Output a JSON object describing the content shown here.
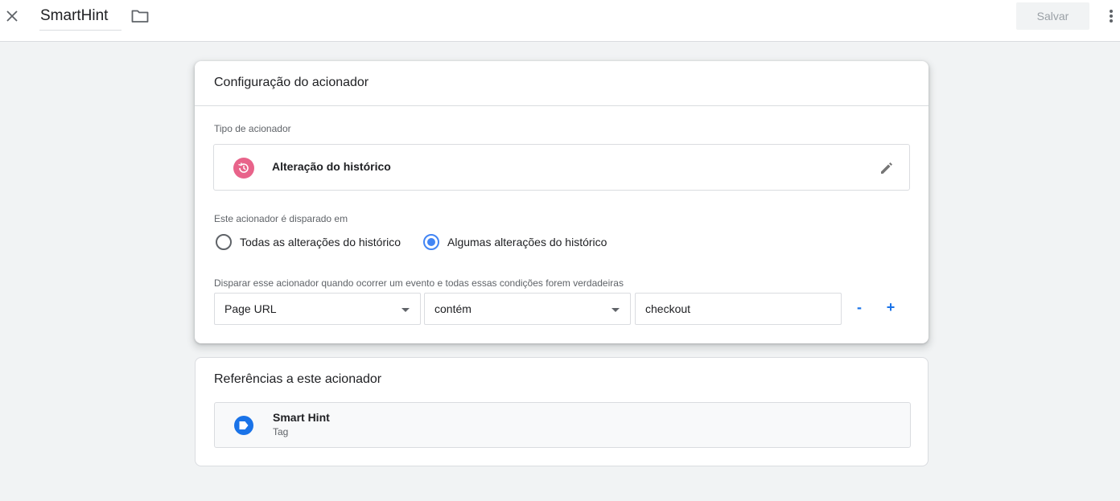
{
  "header": {
    "title": "SmartHint",
    "save_label": "Salvar"
  },
  "config": {
    "title": "Configuração do acionador",
    "trigger_type_label": "Tipo de acionador",
    "trigger_type_name": "Alteração do histórico",
    "fires_on_label": "Este acionador é disparado em",
    "radio_options": [
      {
        "label": "Todas as alterações do histórico",
        "checked": false
      },
      {
        "label": "Algumas alterações do histórico",
        "checked": true
      }
    ],
    "condition_label": "Disparar esse acionador quando ocorrer um evento e todas essas condições forem verdadeiras",
    "condition": {
      "variable": "Page URL",
      "operator": "contém",
      "value": "checkout"
    },
    "remove_label": "-",
    "add_label": "+"
  },
  "references": {
    "title": "Referências a este acionador",
    "items": [
      {
        "name": "Smart Hint",
        "type": "Tag"
      }
    ]
  },
  "colors": {
    "accent": "#1a73e8",
    "radio_checked": "#4285f4",
    "trigger_icon": "#e8638a",
    "background": "#f1f3f4"
  },
  "icons": {
    "close": "close-icon",
    "folder": "folder-icon",
    "more": "more-vert-icon",
    "trigger": "history-icon",
    "edit": "pencil-icon",
    "tag": "tag-icon"
  }
}
